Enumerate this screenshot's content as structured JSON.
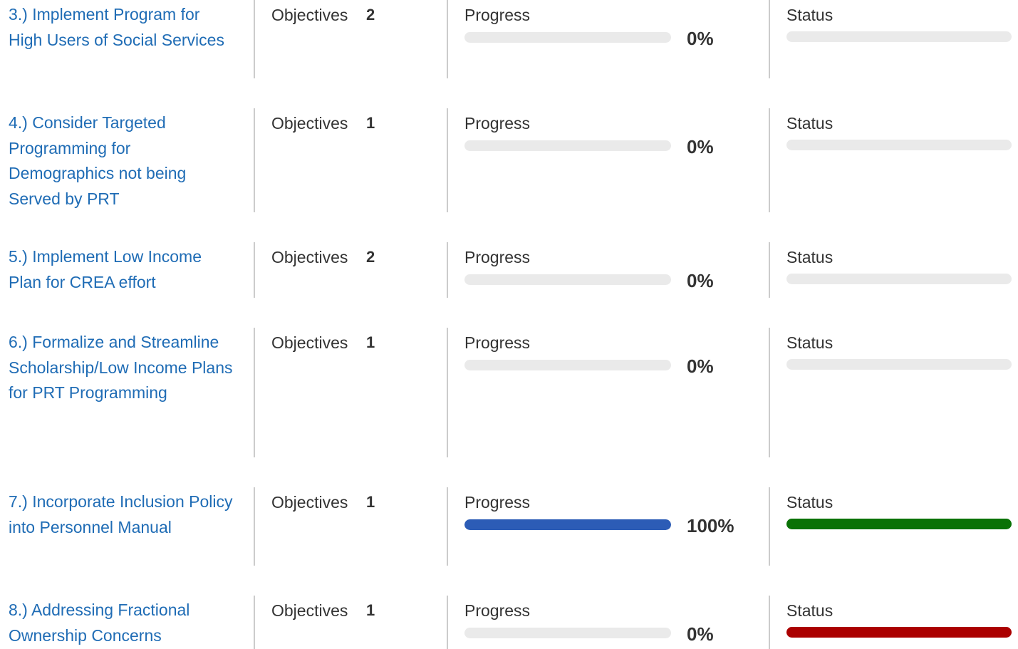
{
  "labels": {
    "objectives": "Objectives",
    "progress": "Progress",
    "status": "Status"
  },
  "colors": {
    "link": "#1f6cb5",
    "track": "#eaeaea",
    "progress_fill": "#2c5cb6",
    "status_complete": "#0a7206",
    "status_off_track": "#ab0000"
  },
  "rows": [
    {
      "title": "3.) Implement Program for High Users of Social Services",
      "objectives": "2",
      "progress": 0,
      "progress_label": "0%",
      "status": "none"
    },
    {
      "title": "4.) Consider Targeted Programming for Demographics not being Served by PRT",
      "objectives": "1",
      "progress": 0,
      "progress_label": "0%",
      "status": "none"
    },
    {
      "title": "5.) Implement Low Income Plan for CREA effort",
      "objectives": "2",
      "progress": 0,
      "progress_label": "0%",
      "status": "none"
    },
    {
      "title": "6.) Formalize and Streamline Scholarship/Low Income Plans for PRT Programming",
      "objectives": "1",
      "progress": 0,
      "progress_label": "0%",
      "status": "none"
    },
    {
      "title": "7.) Incorporate Inclusion Policy into Personnel Manual",
      "objectives": "1",
      "progress": 100,
      "progress_label": "100%",
      "status": "complete"
    },
    {
      "title": "8.) Addressing Fractional Ownership Concerns",
      "objectives": "1",
      "progress": 0,
      "progress_label": "0%",
      "status": "off-track"
    }
  ]
}
